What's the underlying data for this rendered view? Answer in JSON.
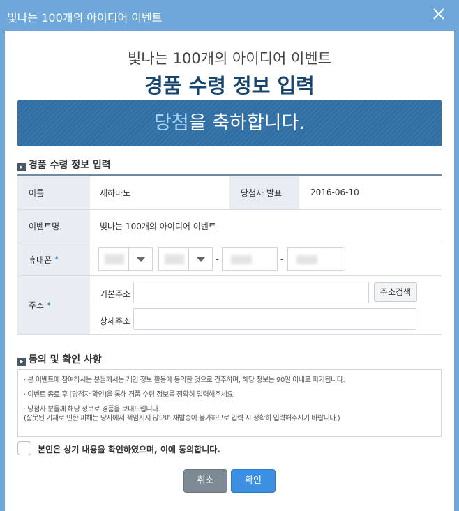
{
  "window": {
    "title": "빛나는 100개의 아이디어 이벤트"
  },
  "header": {
    "event_name": "빛나는 100개의 아이디어 이벤트",
    "title": "경품 수령 정보 입력",
    "banner_highlight": "당첨",
    "banner_rest": "을 축하합니다."
  },
  "form_section": {
    "title": "경품 수령 정보 입력",
    "name_label": "이름",
    "name_value": "세하마노",
    "announce_label": "당첨자 발표",
    "announce_value": "2016-06-10",
    "event_label": "이벤트명",
    "event_value": "빛나는 100개의 아이디어 이벤트",
    "phone_label": "휴대폰",
    "required_mark": "*",
    "dash": "-",
    "address_label": "주소",
    "basic_address_label": "기본주소",
    "detail_address_label": "상세주소",
    "address_search_button": "주소검색"
  },
  "agreement": {
    "title": "동의 및 확인 사항",
    "notices": [
      "· 본 이벤트에 참여하시는 분들께서는 개인 정보 활용에 동의한 것으로 간주하며, 해당 정보는 90일 이내로 파기됩니다.",
      "· 이벤트 종료 후 [당첨자 확인]을 통해 경품 수령 정보를 정확히 입력해주세요.",
      "· 당첨자 분들께 해당 정보로 경품을 보내드립니다.",
      "(잘못된 기재로 인한 피해는 당사에서 책임지지 않으며 재발송이 불가하므로 입력 시 정확히 입력해주시기 바랍니다.)"
    ],
    "checkbox_label": "본인은 상기 내용을 확인하였으며, 이에 동의합니다."
  },
  "buttons": {
    "cancel": "취소",
    "confirm": "확인"
  },
  "colors": {
    "window_frame": "#6ea7d9",
    "banner": "#2f6fa4",
    "title_navy": "#17456d",
    "confirm_button": "#3d8fe1",
    "cancel_button": "#7d8a94"
  }
}
